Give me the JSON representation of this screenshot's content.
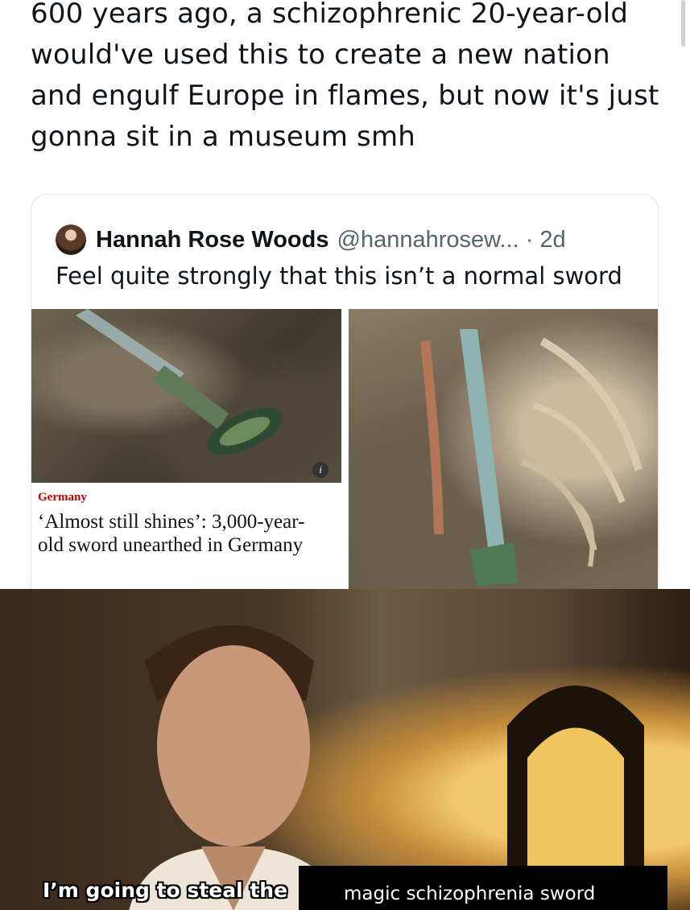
{
  "post": {
    "text": "600 years ago, a schizophrenic 20-year-old would've used this to create a new nation and engulf Europe in flames, but now it's just gonna sit in a museum smh"
  },
  "quoted_post": {
    "author_name": "Hannah Rose Woods",
    "handle_and_time": "@hannahrosew... · 2d",
    "text": "Feel quite strongly that this isn’t a normal sword",
    "article": {
      "section": "Germany",
      "headline": "‘Almost still shines’: 3,000-year-old sword unearthed in Germany",
      "info_badge": "i"
    }
  },
  "meme": {
    "caption_left": "I’m going to steal the",
    "caption_right": "magic schizophrenia sword"
  },
  "colors": {
    "text_primary": "#0f1419",
    "text_secondary": "#536471",
    "card_border": "#e1e6ea",
    "news_section": "#c70000"
  }
}
